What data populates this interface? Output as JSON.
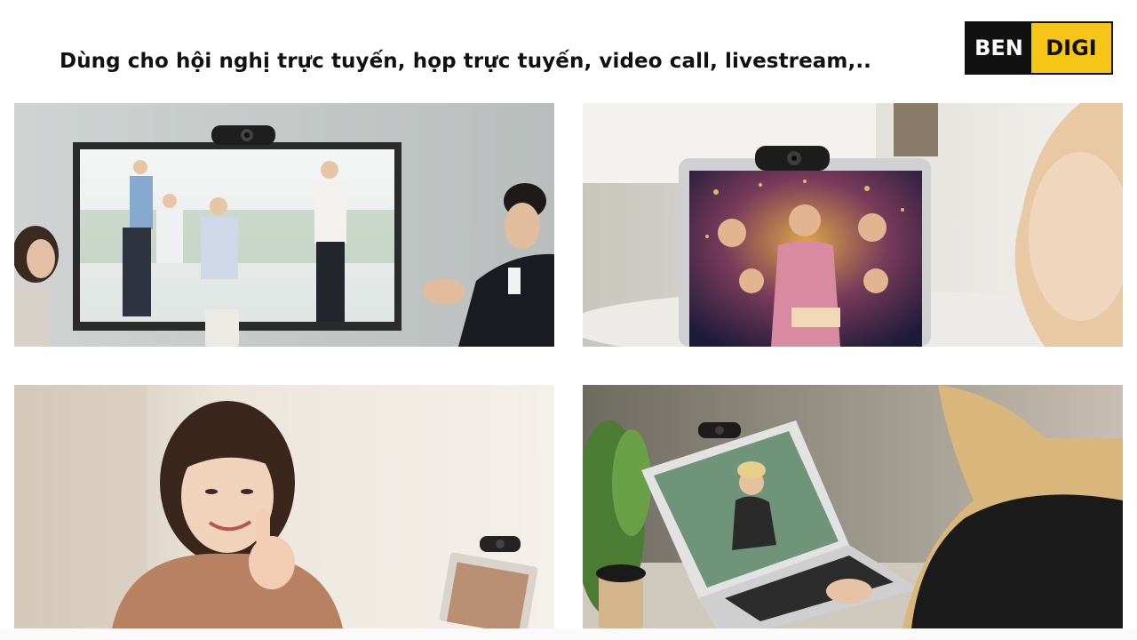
{
  "headline": "Dùng cho hội nghị trực tuyến, họp trực tuyến, video call, livestream,..",
  "logo": {
    "part1": "BEN",
    "part2": "DIGI"
  },
  "colors": {
    "logo_dark": "#111111",
    "logo_accent": "#f5c518"
  },
  "photos": [
    {
      "subject": "video-conference-meeting"
    },
    {
      "subject": "laptop-party-video-call"
    },
    {
      "subject": "woman-thumbs-up-webcam"
    },
    {
      "subject": "laptop-online-class"
    }
  ]
}
